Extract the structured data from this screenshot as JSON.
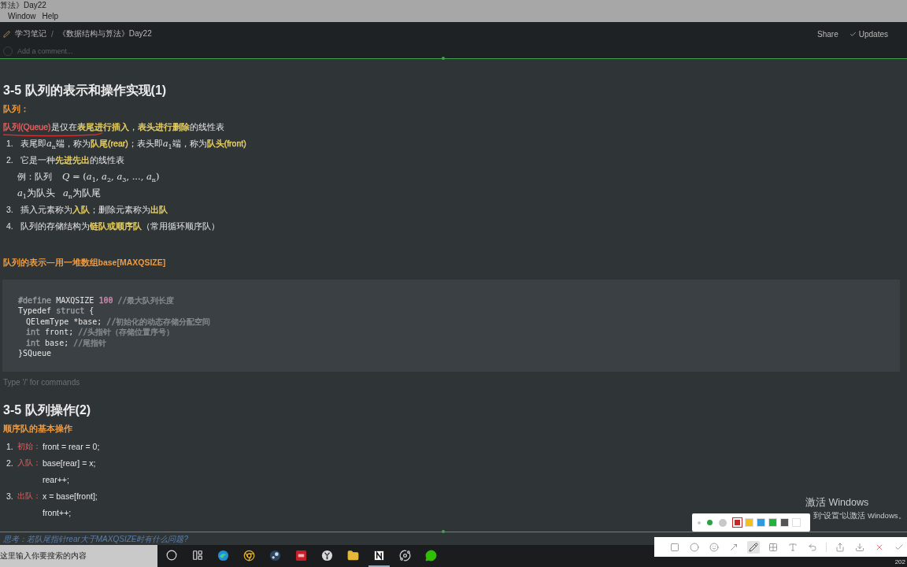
{
  "window": {
    "title": "算法》Day22",
    "menu": [
      "Window",
      "Help"
    ]
  },
  "topbar": {
    "breadcrumb": [
      "学习笔记",
      "《数据结构与算法》Day22"
    ],
    "separator": "/",
    "actions": [
      {
        "label": "Share",
        "kind": "plain"
      },
      {
        "label": "Updates",
        "kind": "check"
      }
    ]
  },
  "comment": {
    "placeholder": "Add a comment..."
  },
  "blocks": [
    {
      "kind": "heading",
      "text": "3-5 队列的表示和操作实现(1)"
    },
    {
      "kind": "subheading",
      "text": "队列："
    },
    {
      "kind": "paragraph",
      "annotated": true,
      "segments": [
        {
          "t": "队列(Queue)",
          "color": "#e2605f"
        },
        {
          "t": "是仅在"
        },
        {
          "t": "表尾进行插入",
          "color": "#e8d163"
        },
        {
          "t": "，"
        },
        {
          "t": "表头进行删除",
          "color": "#e8d163"
        },
        {
          "t": "的线性表"
        }
      ]
    },
    {
      "kind": "item",
      "number": "1.",
      "segments": [
        {
          "t": "表尾即"
        },
        {
          "t": "*a*$_{n}$",
          "math": true
        },
        {
          "t": "端，称为"
        },
        {
          "t": "队尾(rear)",
          "color": "#e8d163"
        },
        {
          "t": "；表头即"
        },
        {
          "t": "*a*$_{1}$",
          "math": true
        },
        {
          "t": "端，称为"
        },
        {
          "t": "队头(front)",
          "color": "#e8d163"
        }
      ]
    },
    {
      "kind": "item",
      "number": "2.",
      "segments": [
        {
          "t": "它是一种"
        },
        {
          "t": "先进先出",
          "color": "#e8d163"
        },
        {
          "t": "的线性表"
        }
      ]
    },
    {
      "kind": "mathline",
      "segments": [
        {
          "t": "例：队列 "
        },
        {
          "t": "*Q* = (*a*$_{1}$, *a*$_{2}$, *a*$_{3}$, ..., *a*$_{n}$)",
          "math": true
        }
      ]
    },
    {
      "kind": "mathline",
      "segments": [
        {
          "t": "*a*$_{1}$为队头",
          "math": true
        },
        {
          "t": "*a*$_{n}$为队尾",
          "math": true
        }
      ]
    },
    {
      "kind": "item",
      "number": "3.",
      "segments": [
        {
          "t": "插入元素称为"
        },
        {
          "t": "入队",
          "color": "#e8d163"
        },
        {
          "t": "；删除元素称为"
        },
        {
          "t": "出队",
          "color": "#e8d163"
        }
      ]
    },
    {
      "kind": "item",
      "number": "4.",
      "segments": [
        {
          "t": "队列的存储结构为"
        },
        {
          "t": "链队或顺序队",
          "color": "#e8d163"
        },
        {
          "t": "（常用循环顺序队）"
        }
      ]
    },
    {
      "kind": "spacer"
    },
    {
      "kind": "subheading",
      "text": "队列的表示—用一堆数组base[MAXQSIZE]"
    },
    {
      "kind": "code",
      "lines": [
        {
          "indent": false,
          "tokens": [
            {
              "t": "#define",
              "color": "#9a9ea2"
            },
            {
              "t": " MAXQSIZE "
            },
            {
              "t": "100",
              "color": "#c68cae"
            },
            {
              "t": " //最大队列长度",
              "color": "#858a8e"
            }
          ]
        },
        {
          "indent": false,
          "tokens": [
            {
              "t": "Typedef"
            },
            {
              "t": " struct",
              "color": "#9a9ea2"
            },
            {
              "t": " {"
            }
          ]
        },
        {
          "indent": true,
          "tokens": [
            {
              "t": "QElemType *base; "
            },
            {
              "t": "//初始化的动态存储分配空间",
              "color": "#858a8e"
            }
          ]
        },
        {
          "indent": true,
          "tokens": [
            {
              "t": "int",
              "color": "#9a9ea2"
            },
            {
              "t": " front; "
            },
            {
              "t": "//头指针（存储位置序号）",
              "color": "#858a8e"
            }
          ]
        },
        {
          "indent": true,
          "tokens": [
            {
              "t": "int",
              "color": "#9a9ea2"
            },
            {
              "t": " base; "
            },
            {
              "t": "//尾指针",
              "color": "#858a8e"
            }
          ]
        },
        {
          "indent": false,
          "tokens": [
            {
              "t": "}SQueue"
            }
          ]
        }
      ]
    },
    {
      "kind": "placeholder",
      "text": "Type '/' for commands"
    },
    {
      "kind": "heading",
      "text": "3-5 队列操作(2)"
    },
    {
      "kind": "subheading",
      "text": "顺序队的基本操作"
    },
    {
      "kind": "op",
      "number": "1.",
      "label": "初始：",
      "lines": [
        "front = rear = 0;"
      ]
    },
    {
      "kind": "op",
      "number": "2.",
      "label": "入队：",
      "lines": [
        "base[rear] = x;",
        "rear++;"
      ]
    },
    {
      "kind": "op",
      "number": "3.",
      "label": "出队：",
      "lines": [
        "x = base[front];",
        "front++;"
      ]
    }
  ],
  "trailing": {
    "text": "思考：若队尾指针rear大于MAXQSIZE时有什么问题?"
  },
  "activation": {
    "title": "激活 Windows",
    "subtitle": "到“设置”以激活 Windows。"
  },
  "palette": {
    "sizes": [
      {
        "kind": "small",
        "selected": false
      },
      {
        "kind": "medium",
        "selected": true
      },
      {
        "kind": "large",
        "selected": false
      }
    ],
    "colors": [
      {
        "color": "#c62828",
        "selected": true
      },
      {
        "color": "#f2c21b",
        "selected": false
      },
      {
        "color": "#2e9be0",
        "selected": false
      },
      {
        "color": "#22b33a",
        "selected": false
      },
      {
        "color": "#555555",
        "selected": false
      },
      {
        "color": "#ffffff",
        "selected": false
      }
    ]
  },
  "tools": [
    {
      "kind": "rectangle",
      "selected": false
    },
    {
      "kind": "ellipse",
      "selected": false
    },
    {
      "kind": "sticker",
      "selected": false
    },
    {
      "kind": "arrow",
      "selected": false
    },
    {
      "kind": "pen",
      "selected": true
    },
    {
      "kind": "mosaic",
      "selected": false
    },
    {
      "kind": "text",
      "selected": false
    },
    {
      "kind": "undo",
      "selected": false
    },
    {
      "kind": "divider"
    },
    {
      "kind": "share",
      "selected": false
    },
    {
      "kind": "download",
      "selected": false
    },
    {
      "kind": "cancel",
      "selected": false
    },
    {
      "kind": "confirm",
      "selected": false
    }
  ],
  "taskbar": {
    "search": {
      "placeholder": "这里输入你要搜索的内容"
    },
    "apps": [
      {
        "kind": "cortana",
        "selected": false
      },
      {
        "kind": "taskview",
        "selected": false
      },
      {
        "kind": "edge",
        "selected": false
      },
      {
        "kind": "chrome",
        "selected": false
      },
      {
        "kind": "steam",
        "selected": false
      },
      {
        "kind": "red",
        "selected": false
      },
      {
        "kind": "yellow",
        "selected": false
      },
      {
        "kind": "folder",
        "selected": false
      },
      {
        "kind": "notion",
        "selected": true
      },
      {
        "kind": "orbit",
        "selected": false
      },
      {
        "kind": "chat",
        "selected": false
      }
    ],
    "clock": "202"
  }
}
